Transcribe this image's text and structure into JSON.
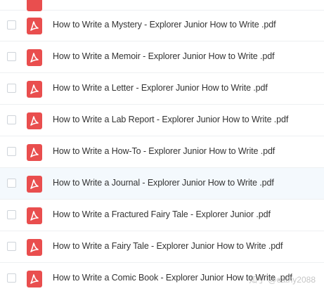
{
  "files": [
    {
      "name": "How to Write a Mystery - Explorer Junior How to Write .pdf",
      "icon": "pdf-icon",
      "highlighted": false
    },
    {
      "name": "How to Write a Memoir - Explorer Junior How to Write .pdf",
      "icon": "pdf-icon",
      "highlighted": false
    },
    {
      "name": "How to Write a Letter - Explorer Junior How to Write .pdf",
      "icon": "pdf-icon",
      "highlighted": false
    },
    {
      "name": "How to Write a Lab Report - Explorer Junior How to Write .pdf",
      "icon": "pdf-icon",
      "highlighted": false
    },
    {
      "name": "How to Write a How-To - Explorer Junior How to Write .pdf",
      "icon": "pdf-icon",
      "highlighted": false
    },
    {
      "name": "How to Write a Journal - Explorer Junior How to Write .pdf",
      "icon": "pdf-icon",
      "highlighted": true
    },
    {
      "name": "How to Write a Fractured Fairy Tale - Explorer Junior .pdf",
      "icon": "pdf-icon",
      "highlighted": false
    },
    {
      "name": "How to Write a Fairy Tale - Explorer Junior How to Write .pdf",
      "icon": "pdf-icon",
      "highlighted": false
    },
    {
      "name": "How to Write a Comic Book - Explorer Junior How to Write .pdf",
      "icon": "pdf-icon",
      "highlighted": false
    }
  ],
  "watermark": "知乎 @cathy2088",
  "colors": {
    "pdf_icon": "#e94e4e",
    "row_border": "#eef0f2",
    "highlight_row": "#f4f9fd",
    "text": "#333333"
  }
}
